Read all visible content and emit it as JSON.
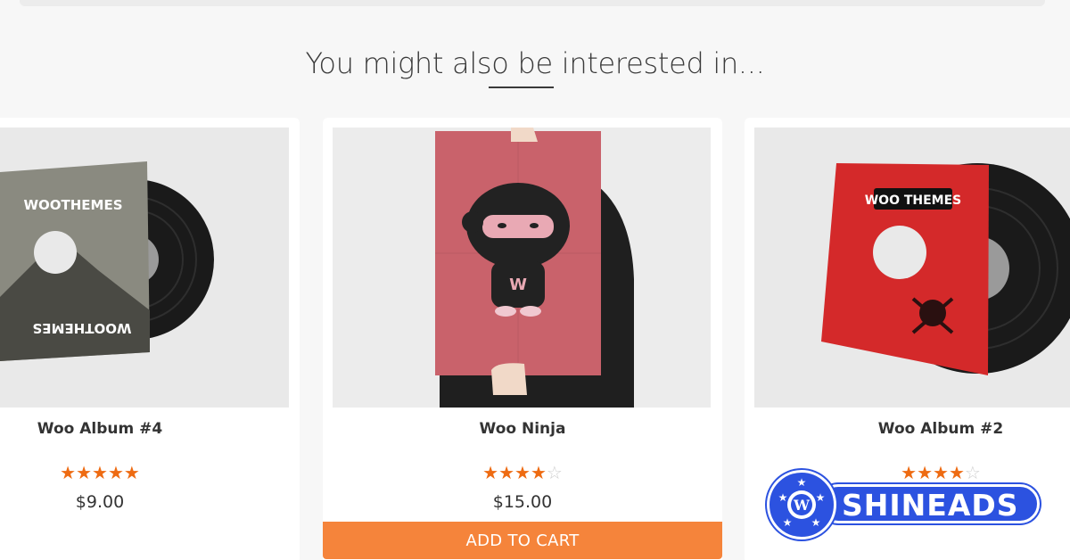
{
  "section": {
    "title": "You might also be interested in..."
  },
  "products": [
    {
      "name": "Woo Album #4",
      "rating": 5,
      "price": "$9.00",
      "sleeve_text": "WOOTHEMES"
    },
    {
      "name": "Woo Ninja",
      "rating": 4,
      "price": "$15.00",
      "button_label": "ADD TO CART",
      "poster_letter": "W"
    },
    {
      "name": "Woo Album #2",
      "rating": 4,
      "sleeve_text": "WOO THEMES"
    }
  ],
  "rating_max": 5,
  "watermark": {
    "text": "SHINEADS"
  },
  "colors": {
    "accent": "#f5843b",
    "star": "#ee6b12",
    "badge": "#2c52e0"
  }
}
